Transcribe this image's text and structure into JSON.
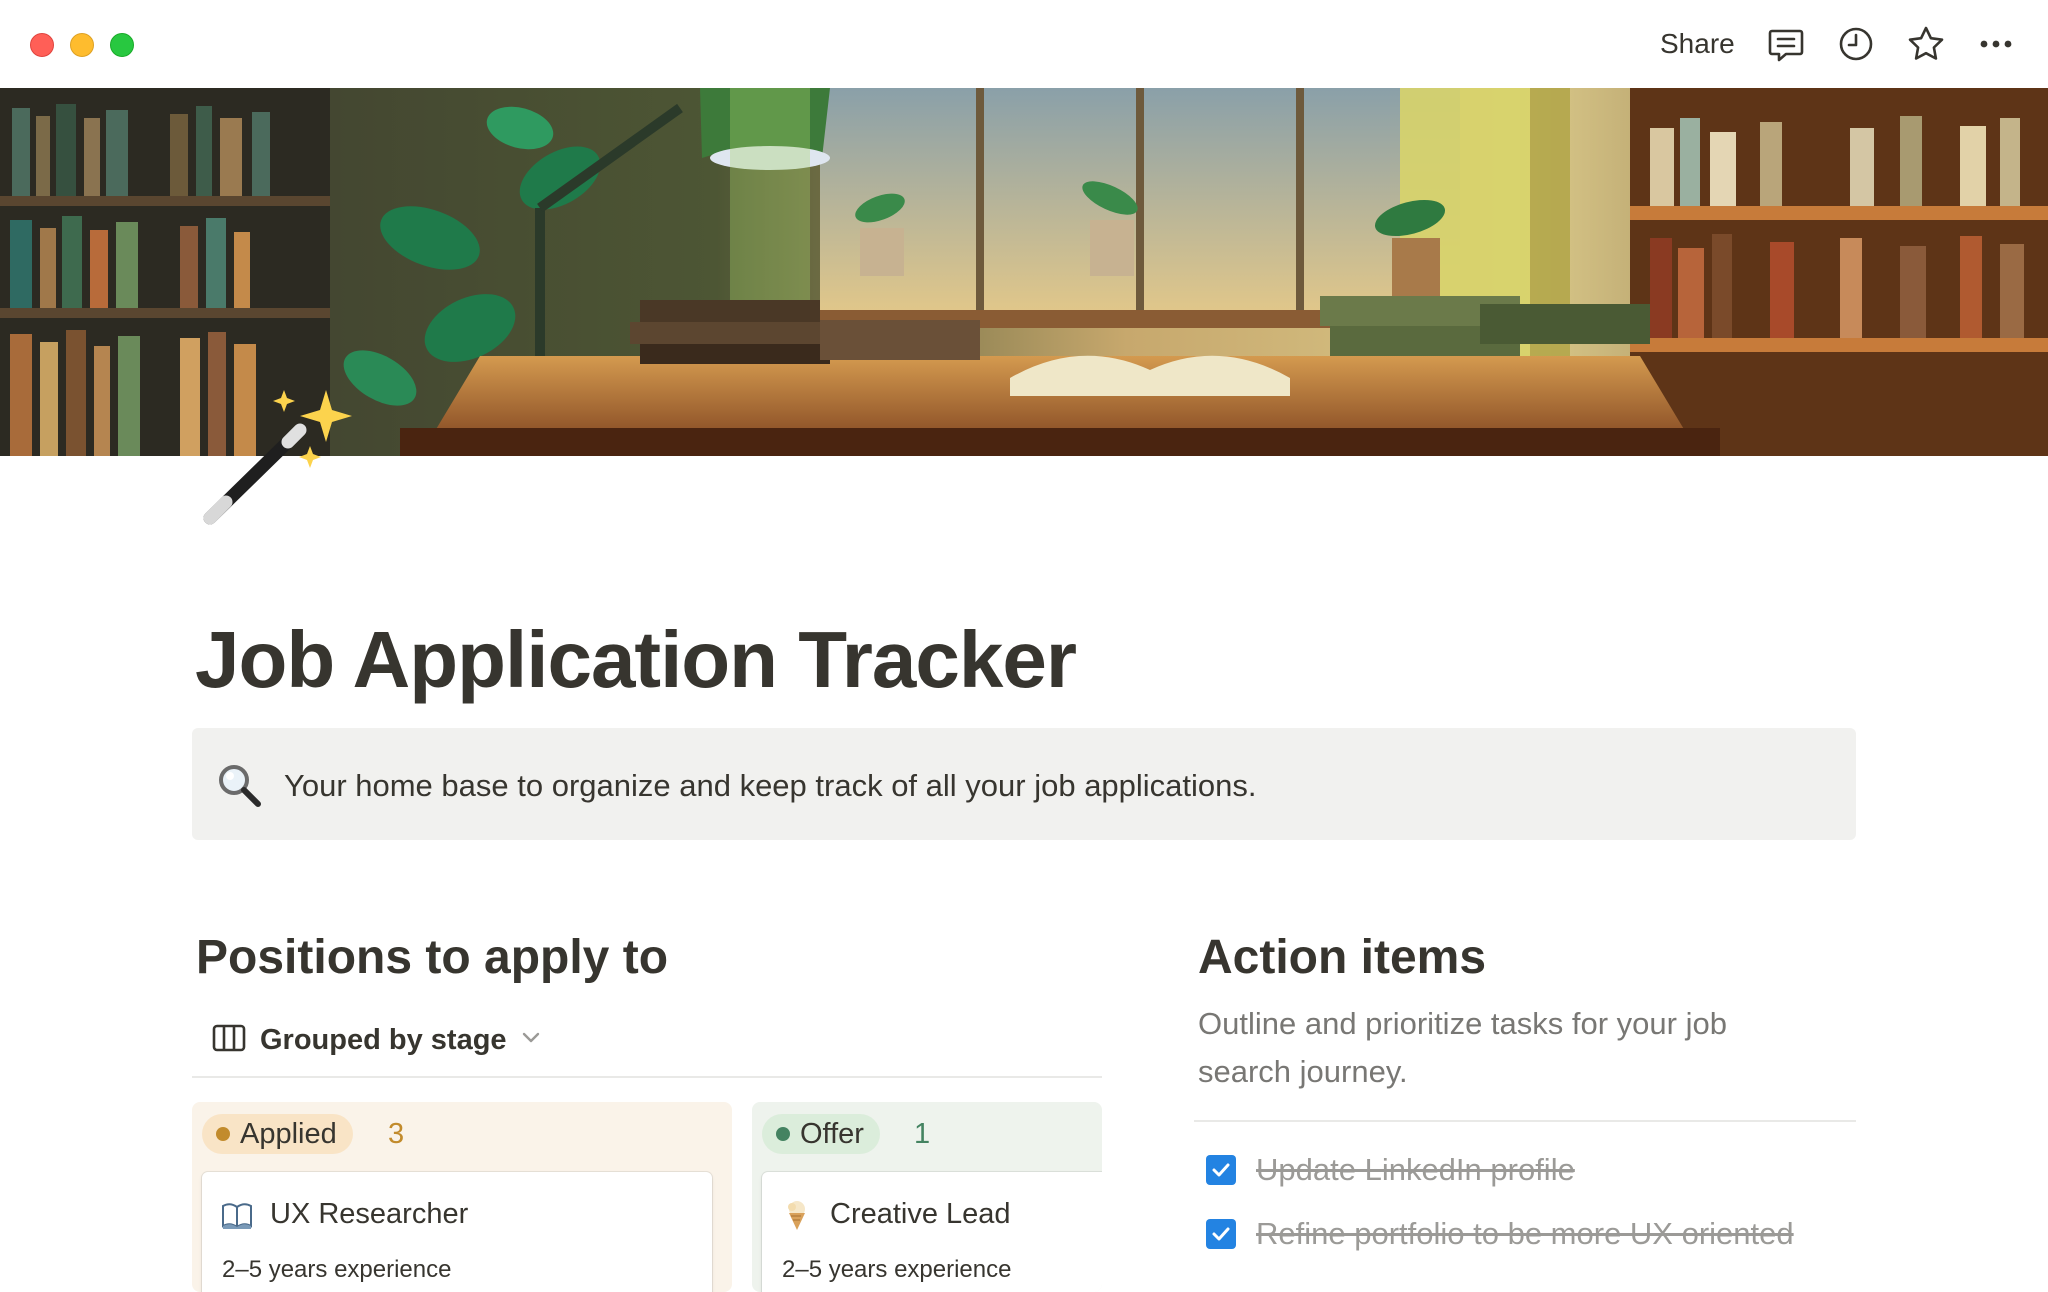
{
  "titlebar": {
    "share_label": "Share",
    "icons": [
      "comment-icon",
      "history-clock-icon",
      "star-icon",
      "more-icon"
    ]
  },
  "cover": {
    "description_icon": "reading-room-illustration"
  },
  "page": {
    "icon": "magic-wand-icon",
    "title": "Job Application Tracker",
    "callout": {
      "icon": "magnifying-glass-icon",
      "text": "Your home base to organize and keep track of all your job applications."
    }
  },
  "positions": {
    "heading": "Positions to apply to",
    "view_label": "Grouped by stage",
    "groups": [
      {
        "name": "Applied",
        "count": "3",
        "color": "#c28b2c",
        "cards": [
          {
            "emoji": "open-book-icon",
            "title": "UX Researcher",
            "subtitle": "2–5 years experience"
          }
        ]
      },
      {
        "name": "Offer",
        "count": "1",
        "color": "#448361",
        "cards": [
          {
            "emoji": "ice-cream-icon",
            "title": "Creative Lead",
            "subtitle": "2–5 years experience"
          }
        ]
      }
    ]
  },
  "action_items": {
    "heading": "Action items",
    "description": "Outline and prioritize tasks for your job search journey.",
    "todos": [
      {
        "text": "Update LinkedIn profile",
        "checked": true
      },
      {
        "text": "Refine portfolio to be more UX oriented",
        "checked": true
      }
    ]
  },
  "colors": {
    "accent": "#2383e2",
    "text": "#37352f",
    "muted": "#787774",
    "callout_bg": "#f1f1ef"
  }
}
